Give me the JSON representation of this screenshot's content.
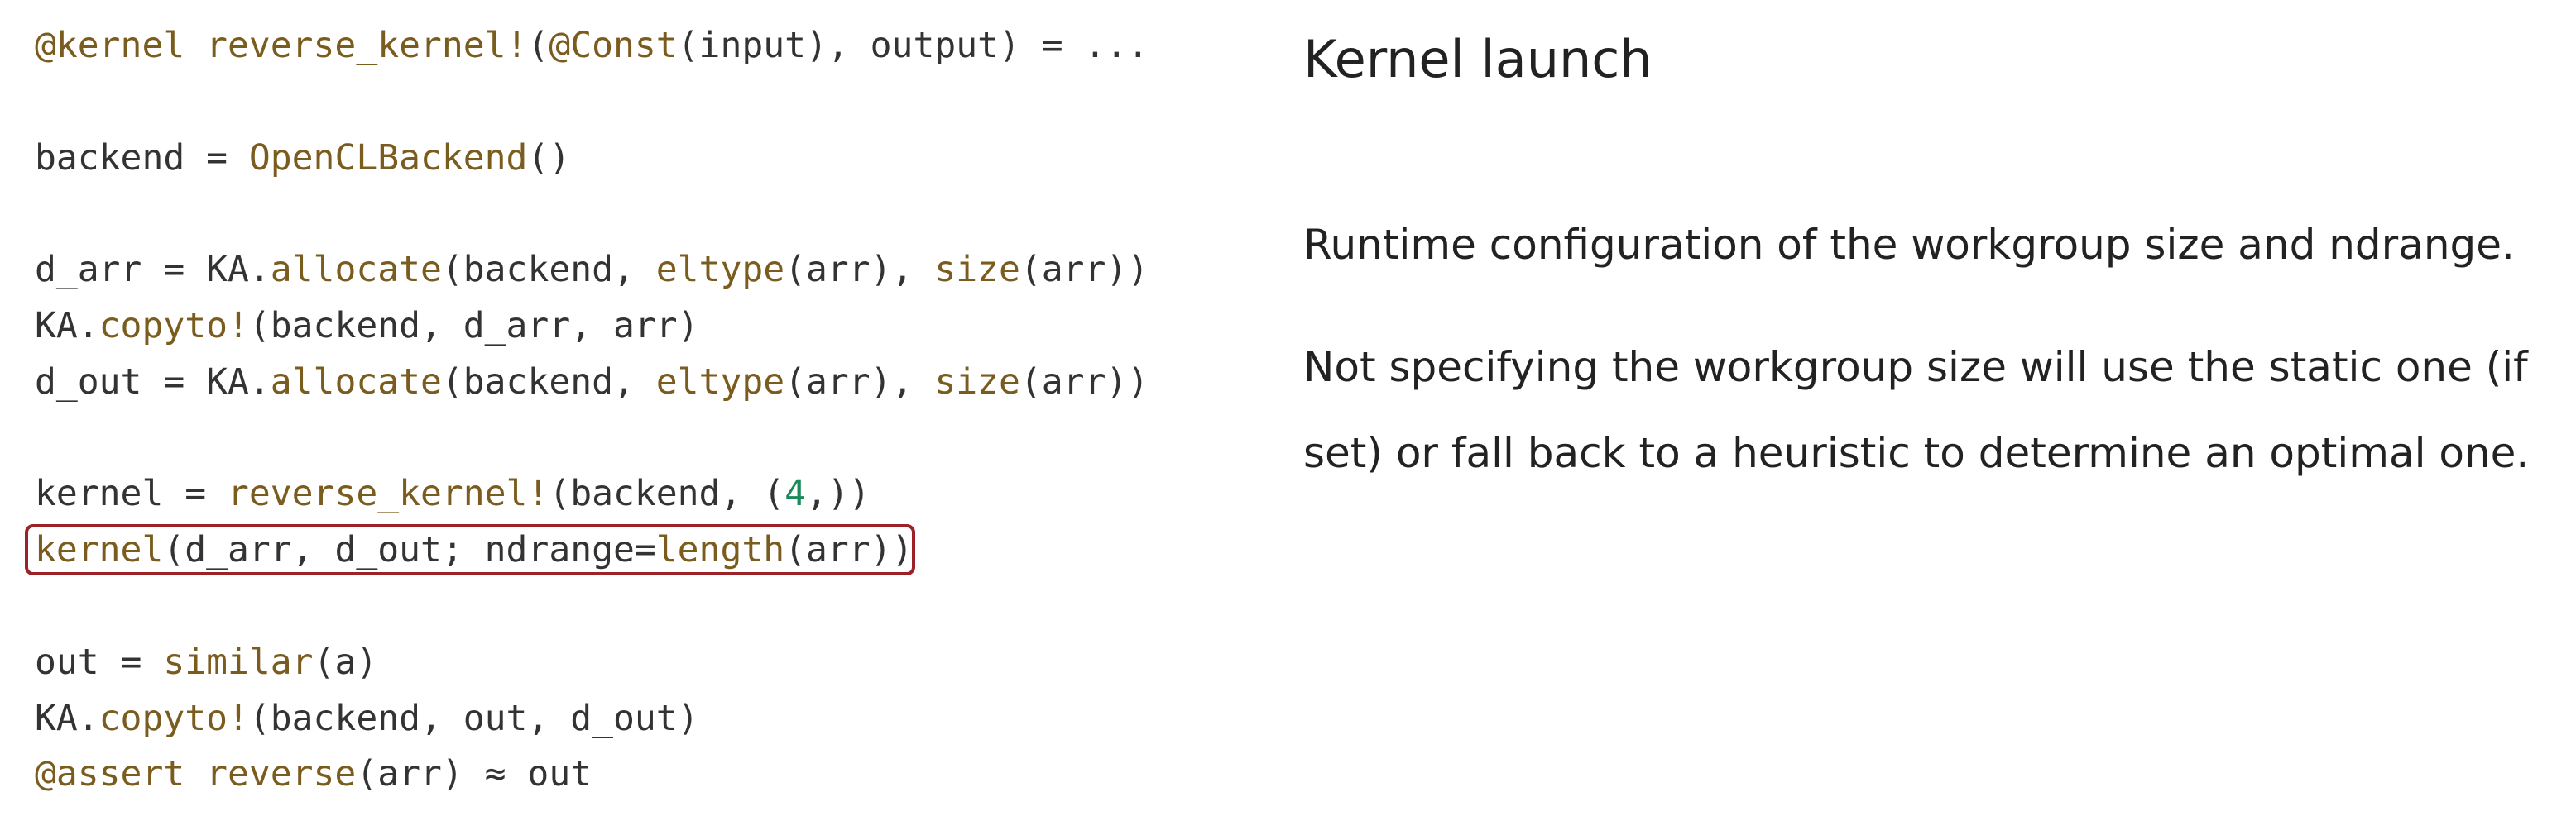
{
  "code": {
    "lines": [
      [
        {
          "t": "@kernel reverse_kernel!",
          "c": "fn"
        },
        {
          "t": "(",
          "c": ""
        },
        {
          "t": "@Const",
          "c": "fn"
        },
        {
          "t": "(input), output) = ...",
          "c": ""
        }
      ],
      [],
      [
        {
          "t": "backend = ",
          "c": ""
        },
        {
          "t": "OpenCLBackend",
          "c": "fn"
        },
        {
          "t": "()",
          "c": ""
        }
      ],
      [],
      [
        {
          "t": "d_arr = KA.",
          "c": ""
        },
        {
          "t": "allocate",
          "c": "fn"
        },
        {
          "t": "(backend, ",
          "c": ""
        },
        {
          "t": "eltype",
          "c": "fn"
        },
        {
          "t": "(arr), ",
          "c": ""
        },
        {
          "t": "size",
          "c": "fn"
        },
        {
          "t": "(arr))",
          "c": ""
        }
      ],
      [
        {
          "t": "KA.",
          "c": ""
        },
        {
          "t": "copyto!",
          "c": "fn"
        },
        {
          "t": "(backend, d_arr, arr)",
          "c": ""
        }
      ],
      [
        {
          "t": "d_out = KA.",
          "c": ""
        },
        {
          "t": "allocate",
          "c": "fn"
        },
        {
          "t": "(backend, ",
          "c": ""
        },
        {
          "t": "eltype",
          "c": "fn"
        },
        {
          "t": "(arr), ",
          "c": ""
        },
        {
          "t": "size",
          "c": "fn"
        },
        {
          "t": "(arr))",
          "c": ""
        }
      ],
      [],
      [
        {
          "t": "kernel = ",
          "c": ""
        },
        {
          "t": "reverse_kernel!",
          "c": "fn"
        },
        {
          "t": "(backend, (",
          "c": ""
        },
        {
          "t": "4",
          "c": "num"
        },
        {
          "t": ",))",
          "c": ""
        }
      ],
      [
        {
          "t": "kernel",
          "c": "fn"
        },
        {
          "t": "(d_arr, d_out; ndrange=",
          "c": ""
        },
        {
          "t": "length",
          "c": "fn"
        },
        {
          "t": "(arr))",
          "c": ""
        }
      ],
      [],
      [
        {
          "t": "out = ",
          "c": ""
        },
        {
          "t": "similar",
          "c": "fn"
        },
        {
          "t": "(a)",
          "c": ""
        }
      ],
      [
        {
          "t": "KA.",
          "c": ""
        },
        {
          "t": "copyto!",
          "c": "fn"
        },
        {
          "t": "(backend, out, d_out)",
          "c": ""
        }
      ],
      [
        {
          "t": "@assert reverse",
          "c": "fn"
        },
        {
          "t": "(arr) ≈ out",
          "c": ""
        }
      ]
    ],
    "highlight_line": 9
  },
  "notes": {
    "title": "Kernel launch",
    "note1": "Runtime configuration of the workgroup size and ndrange.",
    "note2a": "Not specifying the workgroup size will use the static one (if",
    "note2b": "set) or fall back to a heuristic to determine an optimal one."
  },
  "colors": {
    "function": "#7a5c1e",
    "number": "#1a8a5a",
    "text": "#333333",
    "highlight_border": "#9b2226"
  }
}
